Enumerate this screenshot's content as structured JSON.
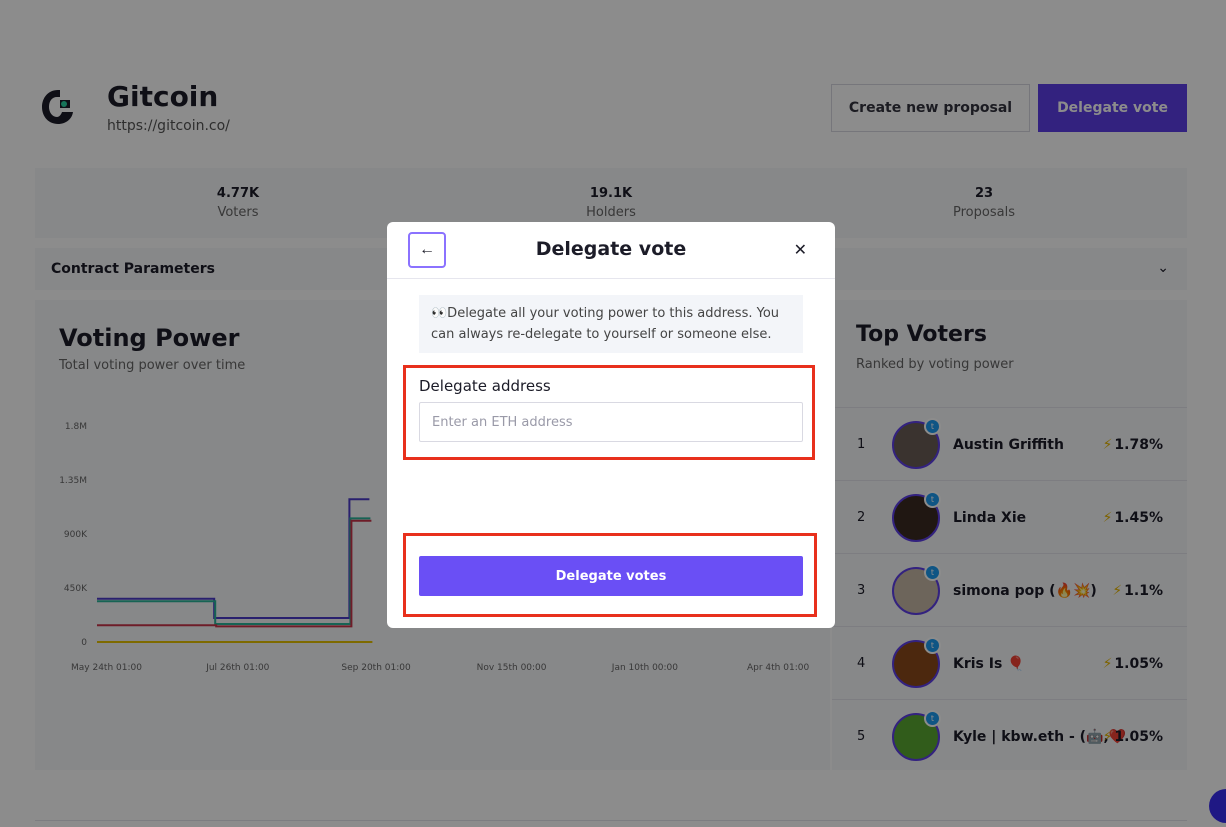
{
  "header": {
    "org_name": "Gitcoin",
    "org_url": "https://gitcoin.co/",
    "create_proposal_label": "Create new proposal",
    "delegate_vote_label": "Delegate vote"
  },
  "stats": [
    {
      "value": "4.77K",
      "label": "Voters"
    },
    {
      "value": "19.1K",
      "label": "Holders"
    },
    {
      "value": "23",
      "label": "Proposals"
    }
  ],
  "contract_parameters": {
    "label": "Contract Parameters",
    "icon": "chevron-down-icon"
  },
  "voting_power": {
    "title": "Voting Power",
    "subtitle": "Total voting power over time"
  },
  "chart_data": {
    "type": "line",
    "title": "",
    "xlabel": "",
    "ylabel": "",
    "y_ticks": [
      "1.8M",
      "1.35M",
      "900K",
      "450K",
      "0"
    ],
    "x_ticks": [
      "May 24th 01:00",
      "Jul 26th 01:00",
      "Sep 20th 01:00",
      "Nov 15th 00:00",
      "Jan 10th 00:00",
      "Apr 4th 01:00"
    ],
    "ylim": [
      0,
      1800000
    ],
    "series": [
      {
        "color": "#4b3bc9",
        "x": [
          "May 24th 01:00",
          "Jul 26th 01:00",
          "Sep 20th 01:00"
        ],
        "values": [
          360000,
          200000,
          1190000
        ]
      },
      {
        "color": "#2bb59a",
        "x": [
          "May 24th 01:00",
          "Jul 26th 01:00",
          "Sep 20th 01:00"
        ],
        "values": [
          340000,
          150000,
          1030000
        ]
      },
      {
        "color": "#c9344a",
        "x": [
          "May 24th 01:00",
          "Jul 26th 01:00",
          "Sep 20th 01:00"
        ],
        "values": [
          140000,
          130000,
          1010000
        ]
      },
      {
        "color": "#e5c100",
        "x": [
          "May 24th 01:00",
          "Jul 26th 01:00",
          "Sep 20th 01:00"
        ],
        "values": [
          0,
          0,
          0
        ]
      }
    ],
    "grid": false
  },
  "top_voters": {
    "title": "Top Voters",
    "subtitle": "Ranked by voting power",
    "rows": [
      {
        "rank": "1",
        "name": "Austin Griffith",
        "pct": "1.78%"
      },
      {
        "rank": "2",
        "name": "Linda Xie",
        "pct": "1.45%"
      },
      {
        "rank": "3",
        "name": "simona pop (🔥💥)",
        "pct": "1.1%"
      },
      {
        "rank": "4",
        "name": "Kris Is 🎈",
        "pct": "1.05%"
      },
      {
        "rank": "5",
        "name": "Kyle | kbw.eth - (🤖,❤️",
        "pct": "1.05%"
      }
    ]
  },
  "modal": {
    "title": "Delegate vote",
    "back_icon": "arrow-left-icon",
    "close_icon": "close-icon",
    "info_text": "👀Delegate all your voting power to this address. You can always re-delegate to yourself or someone else.",
    "address_label": "Delegate address",
    "address_placeholder": "Enter an ETH address",
    "address_value": "",
    "submit_label": "Delegate votes"
  }
}
